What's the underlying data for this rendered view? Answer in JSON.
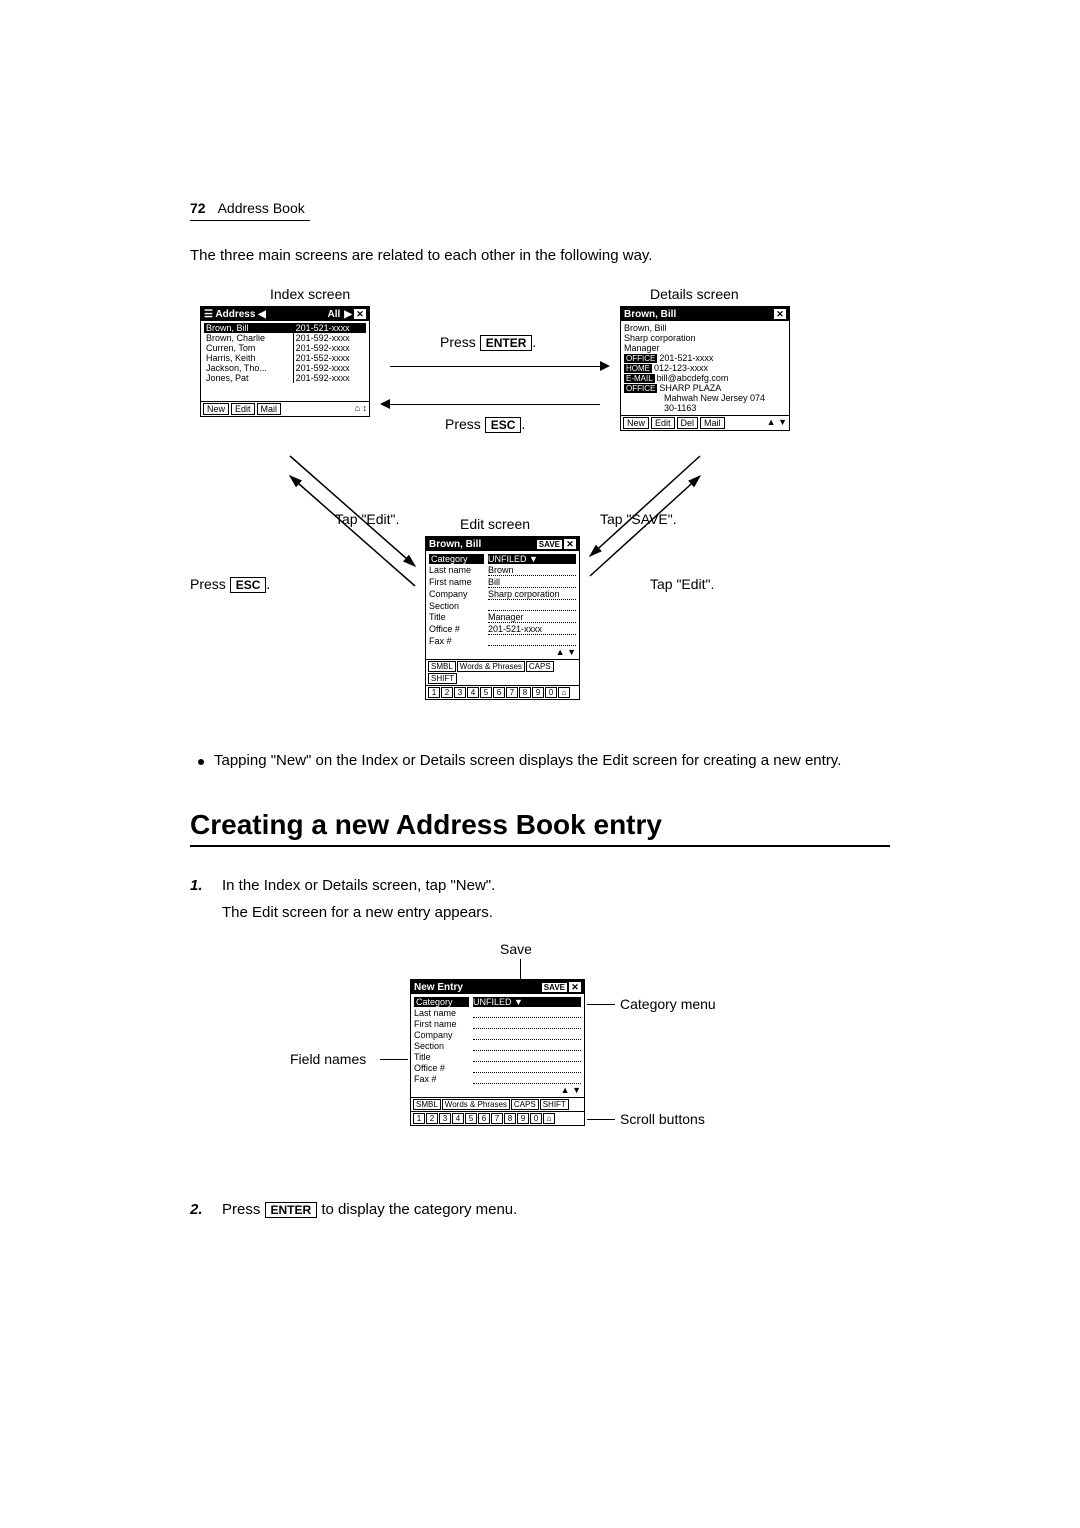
{
  "header": {
    "page_num": "72",
    "section": "Address Book"
  },
  "intro": "The three main screens are related to each other in the following way.",
  "diagram1": {
    "labels": {
      "index": "Index screen",
      "details": "Details screen",
      "edit": "Edit screen",
      "press_enter": "Press",
      "press_esc": "Press",
      "tap_edit": "Tap \"Edit\".",
      "tap_save": "Tap \"SAVE\".",
      "press_esc2": "Press"
    },
    "keys": {
      "enter": "ENTER",
      "esc": "ESC"
    },
    "index_screen": {
      "title": "Address",
      "dropdown": "All",
      "rows": [
        {
          "name": "Brown, Bill",
          "num": "201-521-xxxx",
          "sel": true
        },
        {
          "name": "Brown, Charlie",
          "num": "201-592-xxxx"
        },
        {
          "name": "Curren, Tom",
          "num": "201-592-xxxx"
        },
        {
          "name": "Harris, Keith",
          "num": "201-552-xxxx"
        },
        {
          "name": "Jackson, Tho...",
          "num": "201-592-xxxx"
        },
        {
          "name": "Jones, Pat",
          "num": "201-592-xxxx"
        }
      ],
      "footer": [
        "New",
        "Edit",
        "Mail"
      ]
    },
    "details_screen": {
      "title": "Brown, Bill",
      "lines": [
        "Brown, Bill",
        "Sharp corporation",
        "Manager"
      ],
      "tagged": [
        {
          "tag": "OFFICE",
          "val": "201-521-xxxx"
        },
        {
          "tag": "HOME",
          "val": "012-123-xxxx"
        },
        {
          "tag": "E-MAIL",
          "val": "bill@abcdefg.com"
        },
        {
          "tag": "OFFICE",
          "val": "SHARP PLAZA"
        }
      ],
      "addr": [
        "Mahwah New Jersey 074",
        "30-1163"
      ],
      "footer": [
        "New",
        "Edit",
        "Del",
        "Mail"
      ]
    },
    "edit_screen": {
      "title": "Brown, Bill",
      "save": "SAVE",
      "rows": [
        {
          "k": "Category",
          "v": "UNFILED"
        },
        {
          "k": "Last name",
          "v": "Brown"
        },
        {
          "k": "First name",
          "v": "Bill"
        },
        {
          "k": "Company",
          "v": "Sharp corporation"
        },
        {
          "k": "Section",
          "v": ""
        },
        {
          "k": "Title",
          "v": "Manager"
        },
        {
          "k": "Office #",
          "v": "201-521-xxxx"
        },
        {
          "k": "Fax #",
          "v": ""
        }
      ],
      "kbd_buttons": [
        "SMBL",
        "Words & Phrases",
        "CAPS",
        "SHIFT"
      ],
      "kbd_nums": [
        "1",
        "2",
        "3",
        "4",
        "5",
        "6",
        "7",
        "8",
        "9",
        "0"
      ]
    }
  },
  "bullet": "Tapping \"New\" on the Index or Details screen displays the Edit screen for creating a new entry.",
  "section_title": "Creating a new Address Book entry",
  "step1": {
    "num": "1.",
    "text": "In the Index or Details screen, tap \"New\".",
    "sub": "The Edit screen for a new entry appears."
  },
  "diagram2": {
    "labels": {
      "save": "Save",
      "category_menu": "Category menu",
      "field_names": "Field names",
      "scroll_buttons": "Scroll buttons"
    },
    "screen": {
      "title": "New Entry",
      "save": "SAVE",
      "rows": [
        {
          "k": "Category",
          "v": "UNFILED"
        },
        {
          "k": "Last name",
          "v": ""
        },
        {
          "k": "First name",
          "v": ""
        },
        {
          "k": "Company",
          "v": ""
        },
        {
          "k": "Section",
          "v": ""
        },
        {
          "k": "Title",
          "v": ""
        },
        {
          "k": "Office #",
          "v": ""
        },
        {
          "k": "Fax #",
          "v": ""
        }
      ],
      "kbd_buttons": [
        "SMBL",
        "Words & Phrases",
        "CAPS",
        "SHIFT"
      ],
      "kbd_nums": [
        "1",
        "2",
        "3",
        "4",
        "5",
        "6",
        "7",
        "8",
        "9",
        "0"
      ]
    }
  },
  "step2": {
    "num": "2.",
    "pre": "Press",
    "key": "ENTER",
    "post": "to display the category menu."
  }
}
